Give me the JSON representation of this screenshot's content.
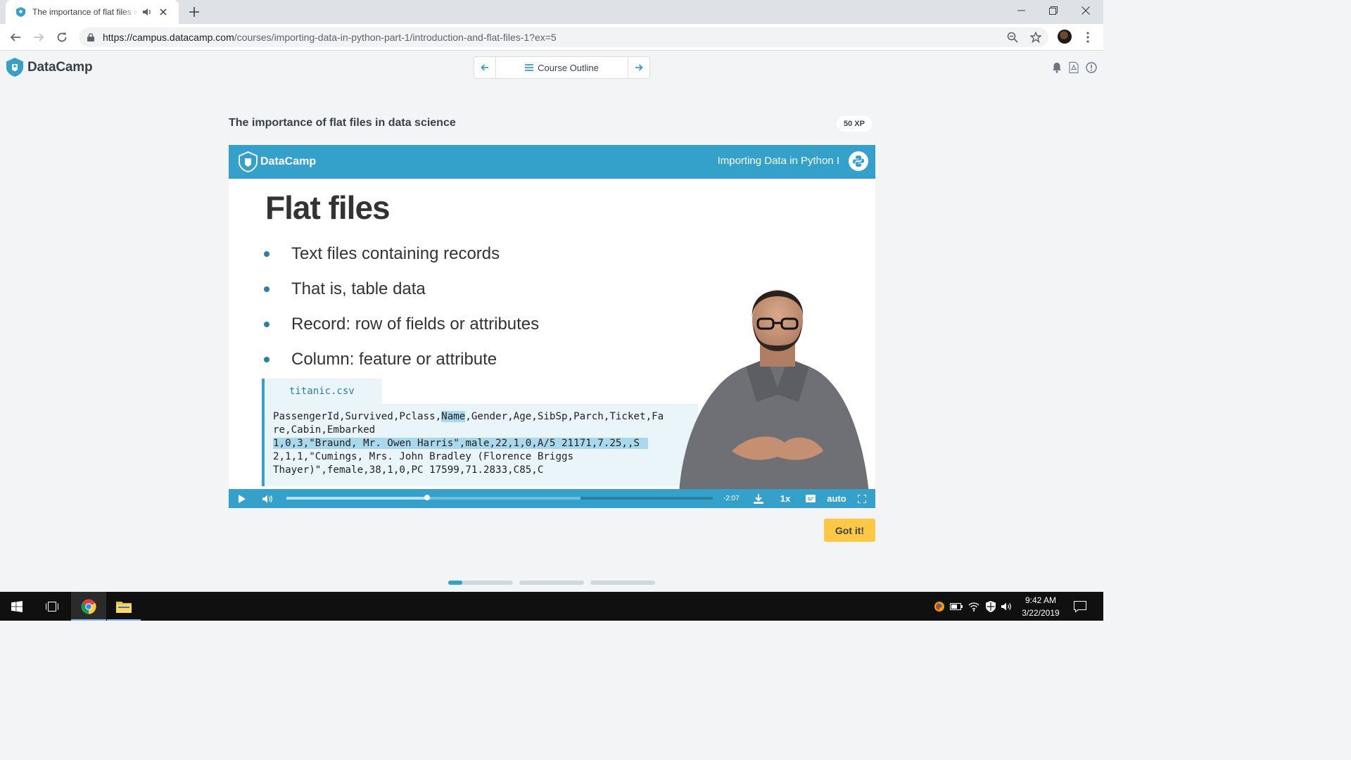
{
  "browser": {
    "tab_title": "The importance of flat files in data science",
    "url_host": "https://campus.datacamp.com",
    "url_path": "/courses/importing-data-in-python-part-1/introduction-and-flat-files-1?ex=5"
  },
  "header": {
    "logo_text": "DataCamp",
    "course_outline_label": "Course Outline"
  },
  "exercise": {
    "title": "The importance of flat files in data science",
    "xp": "50 XP",
    "got_it_label": "Got it!"
  },
  "slide": {
    "logo_text": "DataCamp",
    "course_name": "Importing Data in Python I",
    "title": "Flat files",
    "bullets": [
      "Text files containing records",
      "That is, table data",
      "Record: row of fields or attributes",
      "Column: feature or attribute"
    ],
    "code_filename": "titanic.csv",
    "code": {
      "line1_pre": "PassengerId,Survived,Pclass,",
      "line1_hl": "Name",
      "line1_post": ",Gender,Age,SibSp,Parch,Ticket,Fa",
      "line2": "re,Cabin,Embarked",
      "line3": "1,0,3,\"Braund, Mr. Owen Harris\",male,22,1,0,A/5 21171,7.25,,S",
      "line4": "2,1,1,\"Cumings, Mrs. John Bradley (Florence Briggs",
      "line5": "Thayer)\",female,38,1,0,PC 17599,71.2833,C85,C"
    }
  },
  "player": {
    "time_remaining": "-2:07",
    "speed": "1x",
    "quality": "auto",
    "played_fraction": 0.33,
    "buffered_fraction": 0.69
  },
  "pager": {
    "segments": 3,
    "current_fill_fraction": 0.22
  },
  "taskbar": {
    "time": "9:42 AM",
    "date": "3/22/2019"
  },
  "colors": {
    "accent": "#33a1c9",
    "button_yellow": "#ffc844",
    "text_dark": "#3a4048"
  }
}
